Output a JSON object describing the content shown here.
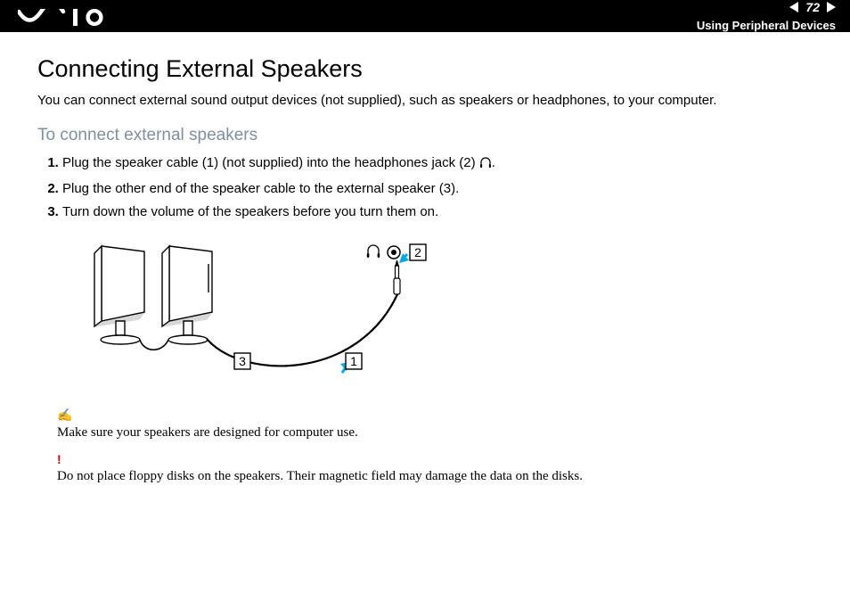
{
  "header": {
    "page_number": "72",
    "breadcrumb": "Using Peripheral Devices"
  },
  "title": "Connecting External Speakers",
  "intro": "You can connect external sound output devices (not supplied), such as speakers or headphones, to your computer.",
  "subheading": "To connect external speakers",
  "steps": [
    "Plug the speaker cable (1) (not supplied) into the headphones jack (2) ",
    "Plug the other end of the speaker cable to the external speaker (3).",
    "Turn down the volume of the speakers before you turn them on."
  ],
  "step1_suffix": ".",
  "diagram": {
    "labels": {
      "l1": "1",
      "l2": "2",
      "l3": "3"
    }
  },
  "note1": {
    "text": "Make sure your speakers are designed for computer use."
  },
  "note2": {
    "text": "Do not place floppy disks on the speakers. Their magnetic field may damage the data on the disks."
  }
}
